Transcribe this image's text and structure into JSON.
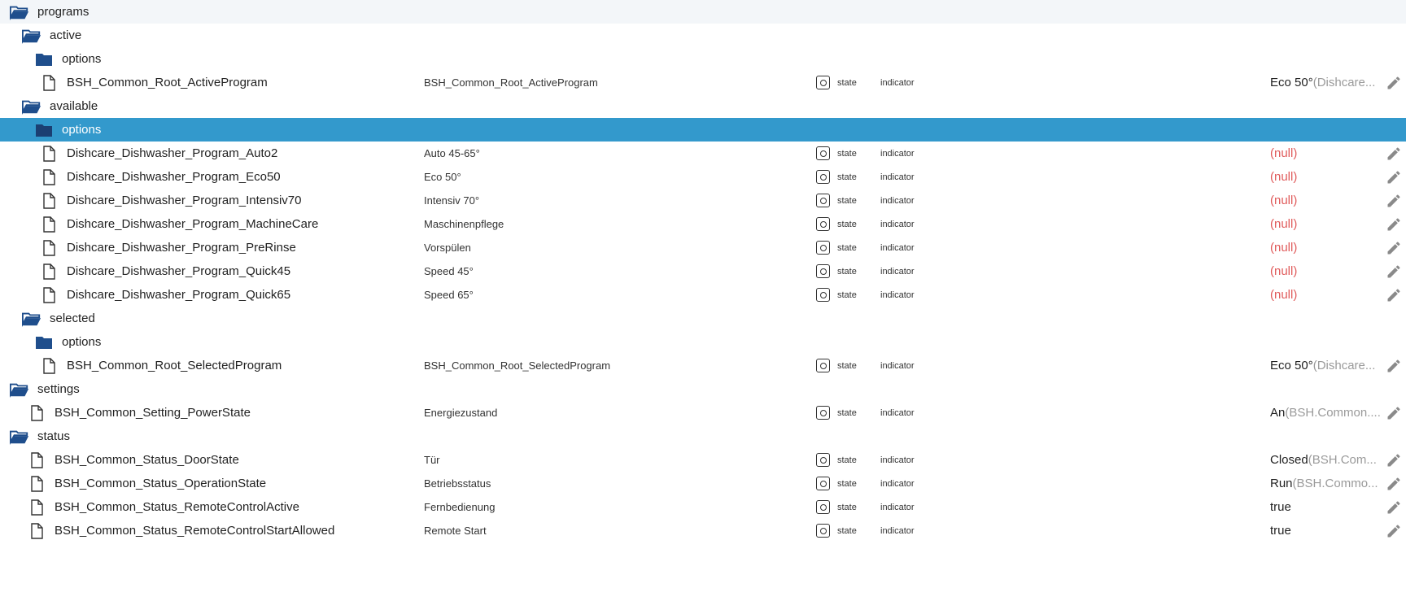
{
  "colors": {
    "folder": "#1f4e8c",
    "selected_row": "#3399cc",
    "null_value": "#e05b5b",
    "value_suffix": "#9a9a9a",
    "edit_icon": "#8a8a8a"
  },
  "rows": [
    {
      "kind": "folder",
      "open": true,
      "depth": 0,
      "name": "programs"
    },
    {
      "kind": "folder",
      "open": true,
      "depth": 1,
      "name": "active"
    },
    {
      "kind": "folder",
      "open": false,
      "depth": 2,
      "name": "options"
    },
    {
      "kind": "state",
      "depth": 2,
      "name": "BSH_Common_Root_ActiveProgram",
      "title": "BSH_Common_Root_ActiveProgram",
      "type": "state",
      "role": "indicator",
      "value": "Eco 50°",
      "suffix": "(Dishcare...",
      "null": false
    },
    {
      "kind": "folder",
      "open": true,
      "depth": 1,
      "name": "available"
    },
    {
      "kind": "folder",
      "open": false,
      "depth": 2,
      "name": "options",
      "selected": true
    },
    {
      "kind": "state",
      "depth": 2,
      "name": "Dishcare_Dishwasher_Program_Auto2",
      "title": "Auto 45-65°",
      "type": "state",
      "role": "indicator",
      "value": "(null)",
      "suffix": "",
      "null": true
    },
    {
      "kind": "state",
      "depth": 2,
      "name": "Dishcare_Dishwasher_Program_Eco50",
      "title": "Eco 50°",
      "type": "state",
      "role": "indicator",
      "value": "(null)",
      "suffix": "",
      "null": true
    },
    {
      "kind": "state",
      "depth": 2,
      "name": "Dishcare_Dishwasher_Program_Intensiv70",
      "title": "Intensiv 70°",
      "type": "state",
      "role": "indicator",
      "value": "(null)",
      "suffix": "",
      "null": true
    },
    {
      "kind": "state",
      "depth": 2,
      "name": "Dishcare_Dishwasher_Program_MachineCare",
      "title": "Maschinenpflege",
      "type": "state",
      "role": "indicator",
      "value": "(null)",
      "suffix": "",
      "null": true
    },
    {
      "kind": "state",
      "depth": 2,
      "name": "Dishcare_Dishwasher_Program_PreRinse",
      "title": "Vorspülen",
      "type": "state",
      "role": "indicator",
      "value": "(null)",
      "suffix": "",
      "null": true
    },
    {
      "kind": "state",
      "depth": 2,
      "name": "Dishcare_Dishwasher_Program_Quick45",
      "title": "Speed 45°",
      "type": "state",
      "role": "indicator",
      "value": "(null)",
      "suffix": "",
      "null": true
    },
    {
      "kind": "state",
      "depth": 2,
      "name": "Dishcare_Dishwasher_Program_Quick65",
      "title": "Speed 65°",
      "type": "state",
      "role": "indicator",
      "value": "(null)",
      "suffix": "",
      "null": true
    },
    {
      "kind": "folder",
      "open": true,
      "depth": 1,
      "name": "selected"
    },
    {
      "kind": "folder",
      "open": false,
      "depth": 2,
      "name": "options"
    },
    {
      "kind": "state",
      "depth": 2,
      "name": "BSH_Common_Root_SelectedProgram",
      "title": "BSH_Common_Root_SelectedProgram",
      "type": "state",
      "role": "indicator",
      "value": "Eco 50°",
      "suffix": "(Dishcare...",
      "null": false
    },
    {
      "kind": "folder",
      "open": true,
      "depth": 0,
      "name": "settings"
    },
    {
      "kind": "state",
      "depth": 1,
      "name": "BSH_Common_Setting_PowerState",
      "title": "Energiezustand",
      "type": "state",
      "role": "indicator",
      "value": "An",
      "suffix": "(BSH.Common....",
      "null": false
    },
    {
      "kind": "folder",
      "open": true,
      "depth": 0,
      "name": "status"
    },
    {
      "kind": "state",
      "depth": 1,
      "name": "BSH_Common_Status_DoorState",
      "title": "Tür",
      "type": "state",
      "role": "indicator",
      "value": "Closed",
      "suffix": "(BSH.Com...",
      "null": false
    },
    {
      "kind": "state",
      "depth": 1,
      "name": "BSH_Common_Status_OperationState",
      "title": "Betriebsstatus",
      "type": "state",
      "role": "indicator",
      "value": "Run",
      "suffix": "(BSH.Commo...",
      "null": false
    },
    {
      "kind": "state",
      "depth": 1,
      "name": "BSH_Common_Status_RemoteControlActive",
      "title": "Fernbedienung",
      "type": "state",
      "role": "indicator",
      "value": "true",
      "suffix": "",
      "null": false
    },
    {
      "kind": "state",
      "depth": 1,
      "name": "BSH_Common_Status_RemoteControlStartAllowed",
      "title": "Remote Start",
      "type": "state",
      "role": "indicator",
      "value": "true",
      "suffix": "",
      "null": false
    }
  ]
}
